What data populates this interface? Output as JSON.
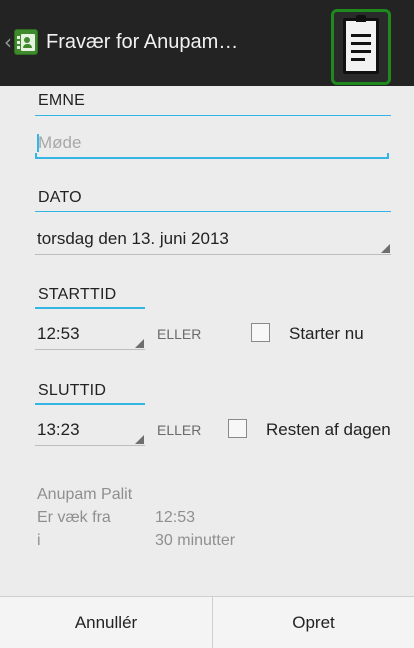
{
  "actionbar": {
    "title": "Fravær for Anupam…",
    "up_icon": "chevron-left-icon",
    "app_icon": "contacts-book-icon",
    "notes_icon": "clipboard-notes-icon"
  },
  "form": {
    "subject": {
      "label": "EMNE",
      "placeholder": "Møde",
      "value": ""
    },
    "date": {
      "label": "DATO",
      "value": "torsdag den 13. juni 2013"
    },
    "start": {
      "label": "STARTTID",
      "time": "12:53",
      "or": "ELLER",
      "checkbox_label": "Starter nu",
      "checked": false
    },
    "end": {
      "label": "SLUTTID",
      "time": "13:23",
      "or": "ELLER",
      "checkbox_label": "Resten af dagen",
      "checked": false
    },
    "summary": {
      "name": "Anupam Palit",
      "away_from_label": "Er væk fra",
      "away_from_value": "12:53",
      "for_label": "i",
      "for_value": "30 minutter"
    }
  },
  "buttons": {
    "cancel": "Annullér",
    "create": "Opret"
  },
  "colors": {
    "accent": "#33b5e5",
    "actionbar_bg": "#232323",
    "highlight": "#1e8a1e",
    "app_icon": "#3e8a2c"
  }
}
